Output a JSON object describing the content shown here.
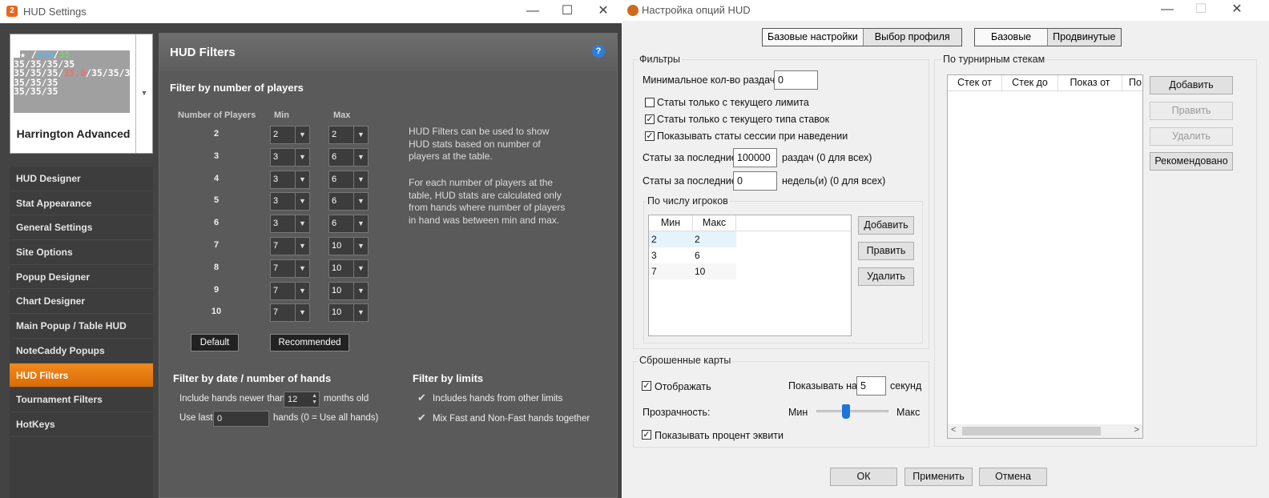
{
  "hud": {
    "title": "HUD Settings",
    "app_icon": "2",
    "profile_name": "Harrington Advanced",
    "preview_lines": [
      [
        "★ /",
        "350",
        "/",
        "35"
      ],
      [
        "35/35/35/35"
      ],
      [
        "35/35/35/",
        "35.0",
        "/35/35/35"
      ],
      [
        "35/35/35"
      ],
      [
        "35/35/35"
      ]
    ],
    "nav": [
      "HUD Designer",
      "Stat Appearance",
      "General Settings",
      "Site Options",
      "Popup Designer",
      "Chart Designer",
      "Main Popup / Table HUD",
      "NoteCaddy Popups",
      "HUD Filters",
      "Tournament Filters",
      "HotKeys"
    ],
    "selected_nav": "HUD Filters",
    "panel_title": "HUD Filters",
    "help": "?",
    "players_heading": "Filter by number of players",
    "col_players": "Number of Players",
    "col_min": "Min",
    "col_max": "Max",
    "rows": [
      {
        "players": "2",
        "min": "2",
        "max": "2"
      },
      {
        "players": "3",
        "min": "3",
        "max": "6"
      },
      {
        "players": "4",
        "min": "3",
        "max": "6"
      },
      {
        "players": "5",
        "min": "3",
        "max": "6"
      },
      {
        "players": "6",
        "min": "3",
        "max": "6"
      },
      {
        "players": "7",
        "min": "7",
        "max": "10"
      },
      {
        "players": "8",
        "min": "7",
        "max": "10"
      },
      {
        "players": "9",
        "min": "7",
        "max": "10"
      },
      {
        "players": "10",
        "min": "7",
        "max": "10"
      }
    ],
    "info1": [
      "HUD Filters can be used to show",
      "HUD stats based on number of",
      "players at the table."
    ],
    "info2": [
      "For each number of players at the",
      "table, HUD stats are calculated only",
      "from hands where number of players",
      "in hand was between min and max."
    ],
    "default_btn": "Default",
    "recommended_btn": "Recommended",
    "date_heading": "Filter by date / number of hands",
    "include_newer": "Include hands newer than",
    "months_value": "12",
    "months_old": "months old",
    "use_last": "Use last",
    "use_last_value": "0",
    "hands_note": "hands (0 = Use all hands)",
    "limits_heading": "Filter by limits",
    "limit_opt1": "Includes hands from other limits",
    "limit_opt2": "Mix Fast and Non-Fast hands together"
  },
  "opt": {
    "title": "Настройка опций HUD",
    "seg1": [
      "Базовые настройки",
      "Выбор профиля"
    ],
    "seg2": [
      "Базовые",
      "Продвинутые"
    ],
    "filters_group": "Фильтры",
    "min_hands_label": "Минимальное кол-во раздач",
    "min_hands_value": "0",
    "chk_limit": "Статы только с текущего лимита",
    "chk_bet_type": "Статы только с текущего типа ставок",
    "chk_session": "Показывать статы сессии при наведении",
    "last_label": "Статы за последние",
    "last_hands_value": "100000",
    "last_hands_unit": "раздач (0 для всех)",
    "last_weeks_value": "0",
    "last_weeks_unit": "недель(и) (0 для всех)",
    "players_group": "По числу игроков",
    "col_min": "Мин",
    "col_max": "Макс",
    "player_rows": [
      [
        "2",
        "2"
      ],
      [
        "3",
        "6"
      ],
      [
        "7",
        "10"
      ]
    ],
    "add": "Добавить",
    "edit": "Править",
    "delete": "Удалить",
    "folded_group": "Сброшенные карты",
    "show": "Отображать",
    "show_for": "Показывать на",
    "show_for_value": "5",
    "seconds": "секунд",
    "transparency": "Прозрачность:",
    "min": "Мин",
    "max": "Макс",
    "transparency_level": 0.4,
    "equity": "Показывать процент эквити",
    "stacks_group": "По турнирным стекам",
    "stack_cols": [
      "Стек от",
      "Стек до",
      "Показ от",
      "По"
    ],
    "recommended": "Рекомендовано",
    "ok": "ОК",
    "apply": "Применить",
    "cancel": "Отмена"
  }
}
